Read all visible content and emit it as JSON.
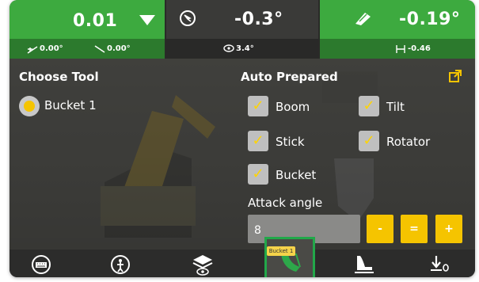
{
  "status": {
    "cell1": {
      "value": "0.01",
      "sub_left": "0.00°",
      "sub_right": "0.00°"
    },
    "cell2": {
      "value": "-0.3°",
      "sub": "3.4°"
    },
    "cell3": {
      "value": "-0.19°",
      "sub": "-0.46"
    }
  },
  "left_panel": {
    "title": "Choose Tool",
    "tools": [
      {
        "label": "Bucket 1",
        "selected": true
      }
    ]
  },
  "right_panel": {
    "title": "Auto Prepared",
    "options": {
      "boom": "Boom",
      "tilt": "Tilt",
      "stick": "Stick",
      "rotator": "Rotator",
      "bucket": "Bucket"
    },
    "attack_angle_label": "Attack angle",
    "attack_angle_value": "8",
    "buttons": {
      "minus": "-",
      "equals": "=",
      "plus": "+"
    }
  },
  "bottom": {
    "tooltip": "Bucket 1"
  },
  "colors": {
    "status_green": "#3daa3f",
    "accent_yellow": "#f5c400",
    "highlight_green": "#22a84a"
  }
}
